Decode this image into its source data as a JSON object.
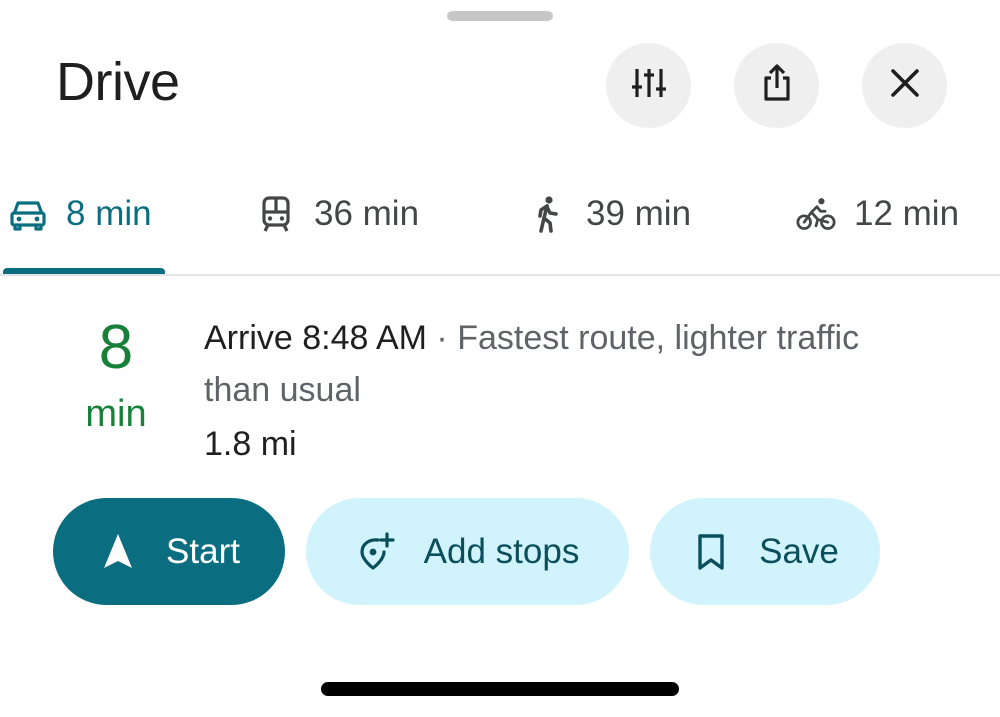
{
  "header": {
    "title": "Drive",
    "buttons": [
      {
        "name": "route-options",
        "icon": "sliders-icon"
      },
      {
        "name": "share",
        "icon": "share-icon"
      },
      {
        "name": "close",
        "icon": "close-icon"
      }
    ]
  },
  "tabs": [
    {
      "mode": "drive",
      "icon": "car-icon",
      "label": "8 min",
      "active": true
    },
    {
      "mode": "transit",
      "icon": "train-icon",
      "label": "36 min",
      "active": false
    },
    {
      "mode": "walk",
      "icon": "walking-icon",
      "label": "39 min",
      "active": false
    },
    {
      "mode": "bike",
      "icon": "bicycle-icon",
      "label": "12 min",
      "active": false
    }
  ],
  "route": {
    "duration_value": "8",
    "duration_unit": "min",
    "arrive": "Arrive 8:48 AM",
    "separator": " · ",
    "description": "Fastest route, lighter traffic than usual",
    "distance": "1.8 mi"
  },
  "actions": {
    "start_label": "Start",
    "add_stops_label": "Add stops",
    "save_label": "Save"
  },
  "colors": {
    "accent": "#0b6e80",
    "duration_green": "#188038",
    "secondary_button_bg": "#d1f3fb"
  }
}
